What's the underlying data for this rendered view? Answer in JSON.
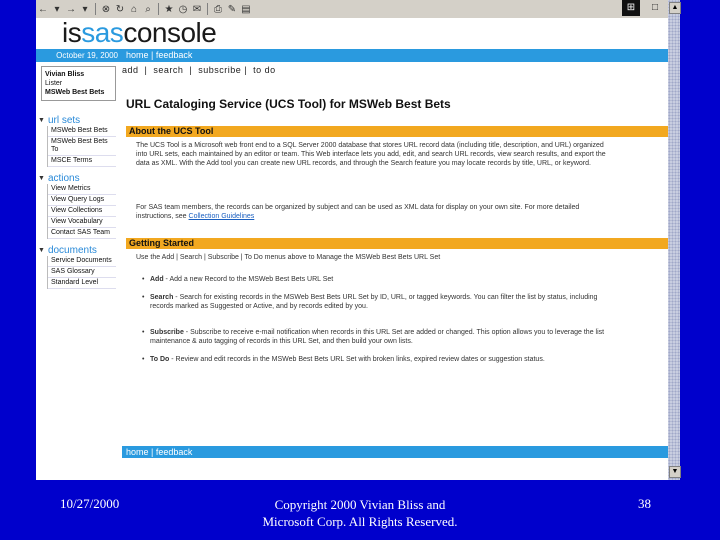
{
  "browser": {
    "toolbar_icons": [
      "back-icon",
      "dropdown-icon",
      "forward-icon",
      "dropdown-icon",
      "stop-icon",
      "refresh-icon",
      "home-icon",
      "search-icon",
      "favorites-icon",
      "history-icon",
      "mail-icon",
      "print-icon",
      "edit-icon",
      "discuss-icon"
    ],
    "toolbar_glyphs": [
      "←",
      "▾",
      "→",
      "▾",
      "⊗",
      "↻",
      "⌂",
      "⌕",
      "★",
      "◷",
      "✉",
      "⎙",
      "✎",
      "▤"
    ]
  },
  "logo": {
    "part1": "is",
    "part2": "sas",
    "part3": "console"
  },
  "header": {
    "date": "October 19, 2000",
    "home": "home",
    "feedback": "feedback",
    "sep": " | ",
    "subnav": [
      "add",
      "search",
      "subscribe",
      "to do"
    ]
  },
  "sidebar": {
    "box": [
      "Vivian Bliss",
      "Lister",
      "MSWeb Best Bets"
    ],
    "sections": [
      {
        "title": "url sets",
        "items": [
          "MSWeb Best Bets",
          "MSWeb Best Bets To",
          "MSCE Terms"
        ]
      },
      {
        "title": "actions",
        "items": [
          "View Metrics",
          "View Query Logs",
          "View Collections",
          "View Vocabulary",
          "Contact SAS Team"
        ]
      },
      {
        "title": "documents",
        "items": [
          "Service Documents",
          "SAS Glossary",
          "Standard Level"
        ]
      }
    ]
  },
  "main": {
    "title": "URL Cataloging Service (UCS Tool) for MSWeb Best Bets",
    "about_head": "About the UCS Tool",
    "about_p1": "The UCS Tool is a Microsoft web front end to a SQL Server 2000 database that stores URL record data (including title, description, and URL) organized into URL sets, each maintained by an editor or team. This Web interface lets you add, edit, and search URL records, view search results, and export the data as XML. With the Add tool you can create new URL records, and through the Search feature you may locate records by title, URL, or keyword.",
    "about_p2_pre": "For SAS team members, the records can be organized by subject and can be used as XML data for display on your own site. For more detailed instructions, see ",
    "about_p2_link": "Collection Guidelines",
    "started_head": "Getting Started",
    "started_intro": "Use the Add | Search | Subscribe | To Do menus above to Manage the MSWeb Best Bets URL Set",
    "bullets": [
      {
        "strong": "Add",
        "text": " - Add a new Record to the MSWeb Best Bets URL Set"
      },
      {
        "strong": "Search",
        "text": " - Search for existing records in the MSWeb Best Bets URL Set by ID, URL, or tagged keywords. You can filter the list by status, including records marked as Suggested or Active, and by records edited by you."
      },
      {
        "strong": "Subscribe",
        "text": " - Subscribe to receive e-mail notification when records in this URL Set are added or changed. This option allows you to leverage the list maintenance & auto tagging of records in this URL Set, and then build your own lists."
      },
      {
        "strong": "To Do",
        "text": " - Review and edit records in the MSWeb Best Bets URL Set with broken links, expired review dates or suggestion status."
      }
    ]
  },
  "slide_footer": {
    "date": "10/27/2000",
    "copyright_line1": "Copyright 2000 Vivian Bliss and",
    "copyright_line2": "Microsoft Corp. All Rights Reserved.",
    "page": "38"
  },
  "colors": {
    "slide_bg": "#0000cc",
    "accent_blue": "#2a9adf",
    "section_orange": "#f2a820"
  }
}
